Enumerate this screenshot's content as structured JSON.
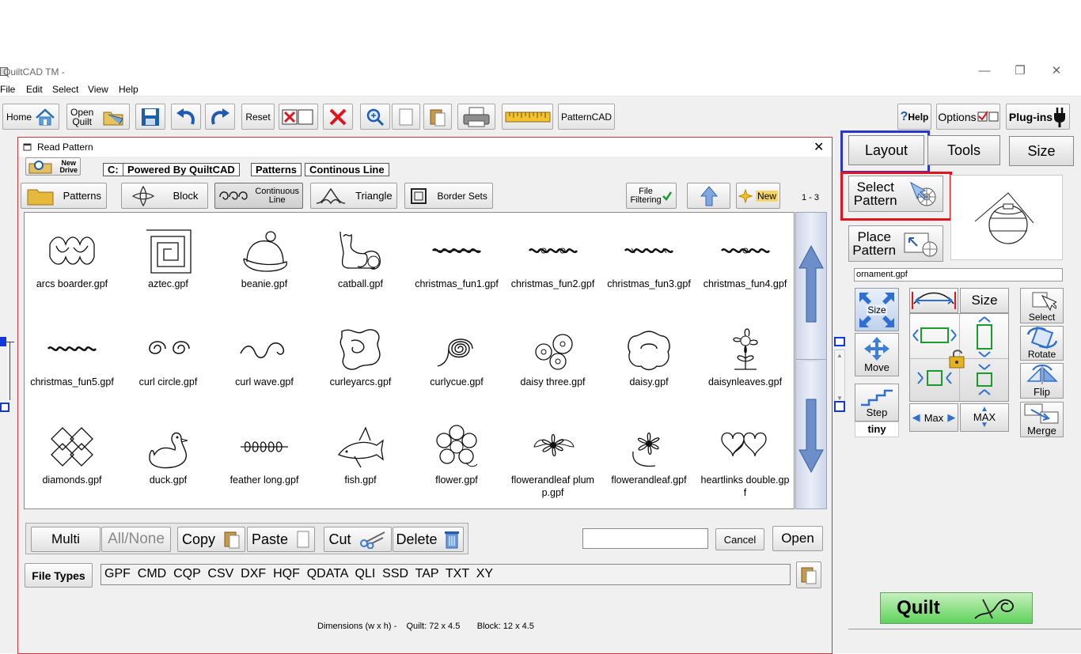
{
  "window": {
    "title": "QuiltCAD TM -",
    "minimize": "—",
    "restore": "❐",
    "close": "✕"
  },
  "menu": [
    "File",
    "Edit",
    "Select",
    "View",
    "Help"
  ],
  "toolbar": {
    "home": "Home",
    "open_quilt_1": "Open",
    "open_quilt_2": "Quilt",
    "reset": "Reset",
    "patterncad": "PatternCAD",
    "help": "Help",
    "options": "Options",
    "plugins": "Plug-ins"
  },
  "dialog": {
    "title": "Read Pattern",
    "new_drive_1": "New",
    "new_drive_2": "Drive",
    "path": [
      "C:",
      "Powered By QuiltCAD",
      "Patterns",
      "Continous Line"
    ],
    "categories": {
      "patterns": "Patterns",
      "block": "Block",
      "continuous_1": "Continuous",
      "continuous_2": "Line",
      "triangle": "Triangle",
      "border_sets": "Border Sets"
    },
    "file_filtering_1": "File",
    "file_filtering_2": "Filtering",
    "new_label": "New",
    "page_range": "1 - 3",
    "files": [
      "arcs boarder.gpf",
      "aztec.gpf",
      "beanie.gpf",
      "catball.gpf",
      "christmas_fun1.gpf",
      "christmas_fun2.gpf",
      "christmas_fun3.gpf",
      "christmas_fun4.gpf",
      "christmas_fun5.gpf",
      "curl circle.gpf",
      "curl wave.gpf",
      "curleyarcs.gpf",
      "curlycue.gpf",
      "daisy three.gpf",
      "daisy.gpf",
      "daisynleaves.gpf",
      "diamonds.gpf",
      "duck.gpf",
      "feather long.gpf",
      "fish.gpf",
      "flower.gpf",
      "flowerandleaf plump.gpf",
      "flowerandleaf.gpf",
      "heartlinks double.gpf"
    ],
    "actions": {
      "multi": "Multi",
      "all_none": "All/None",
      "copy": "Copy",
      "paste": "Paste",
      "cut": "Cut",
      "delete": "Delete"
    },
    "filename_value": "",
    "cancel": "Cancel",
    "open": "Open",
    "file_types_label": "File Types",
    "file_types": "GPF  CMD  CQP  CSV  DXF  HQF  QDATA  QLI  SSD  TAP  TXT  XY"
  },
  "right_panel": {
    "tabs": {
      "layout": "Layout",
      "tools": "Tools",
      "size": "Size"
    },
    "select_pattern_1": "Select",
    "select_pattern_2": "Pattern",
    "place_pattern_1": "Place",
    "place_pattern_2": "Pattern",
    "current_file": "ornament.gpf",
    "size_arrows": "Size",
    "size_btn": "Size",
    "select": "Select",
    "move": "Move",
    "rotate": "Rotate",
    "step": "Step",
    "step_value": "tiny",
    "flip": "Flip",
    "max": "Max",
    "max_caps": "MAX",
    "merge": "Merge",
    "quilt": "Quilt"
  },
  "status": {
    "dimensions": "Dimensions (w x h) -",
    "quilt": "Quilt: 72 x 4.5",
    "block": "Block: 12 x 4.5"
  },
  "colors": {
    "highlight_red": "#e0141e",
    "highlight_blue": "#2a35c9",
    "quilt_green": "#5fd35a",
    "scroll_blue": "#6d8fc9"
  }
}
